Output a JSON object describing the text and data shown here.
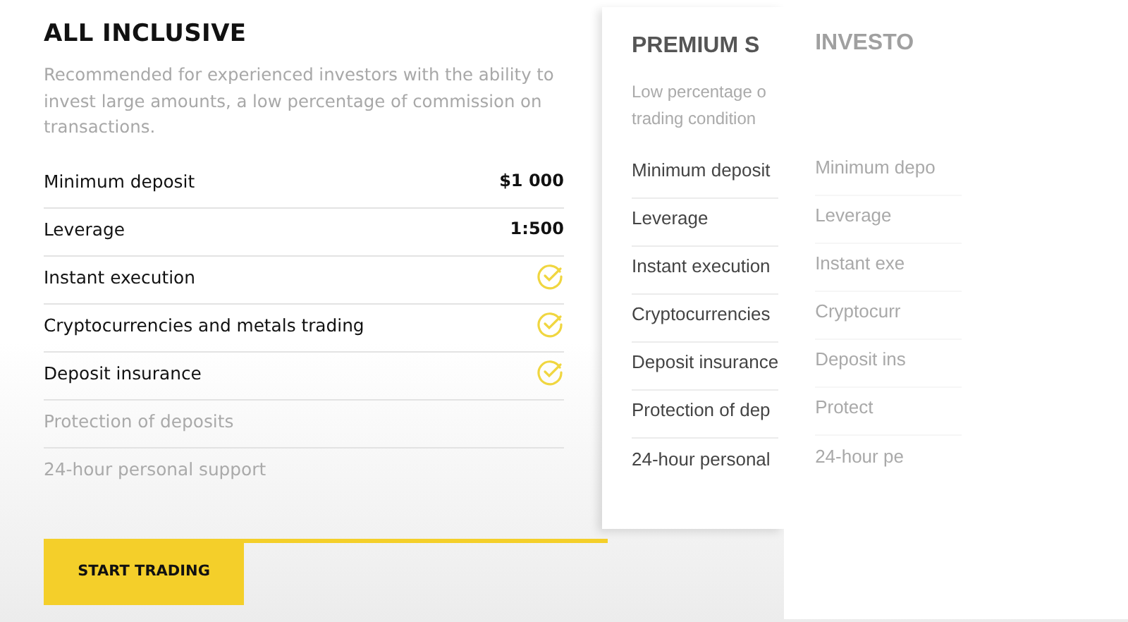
{
  "plan": {
    "title": "ALL INCLUSIVE",
    "description": "Recommended for experienced investors with the ability to invest large amounts, a low percentage of commission on transactions.",
    "features": [
      {
        "label": "Minimum deposit",
        "kind": "value",
        "value": "$1 000",
        "disabled": false
      },
      {
        "label": "Leverage",
        "kind": "value",
        "value": "1:500",
        "disabled": false
      },
      {
        "label": "Instant execution",
        "kind": "check",
        "disabled": false
      },
      {
        "label": "Cryptocurrencies and metals trading",
        "kind": "check",
        "disabled": false
      },
      {
        "label": "Deposit insurance",
        "kind": "check",
        "disabled": false
      },
      {
        "label": "Protection of deposits",
        "kind": "none",
        "disabled": true
      },
      {
        "label": "24-hour personal support",
        "kind": "none",
        "disabled": true
      }
    ],
    "button": "START TRADING"
  },
  "cards": [
    {
      "title": "PREMIUM S",
      "faded": false,
      "description": [
        "Low percentage o",
        "trading condition"
      ],
      "features": [
        "Minimum deposit",
        "Leverage",
        "Instant execution",
        "Cryptocurrencies",
        "Deposit insurance",
        "Protection of dep",
        "24-hour personal"
      ]
    },
    {
      "title": "INVESTO",
      "faded": true,
      "features": [
        "Minimum depo",
        "Leverage",
        "Instant exe",
        "Cryptocurr",
        "Deposit ins",
        "Protect",
        "24-hour pe"
      ]
    }
  ]
}
